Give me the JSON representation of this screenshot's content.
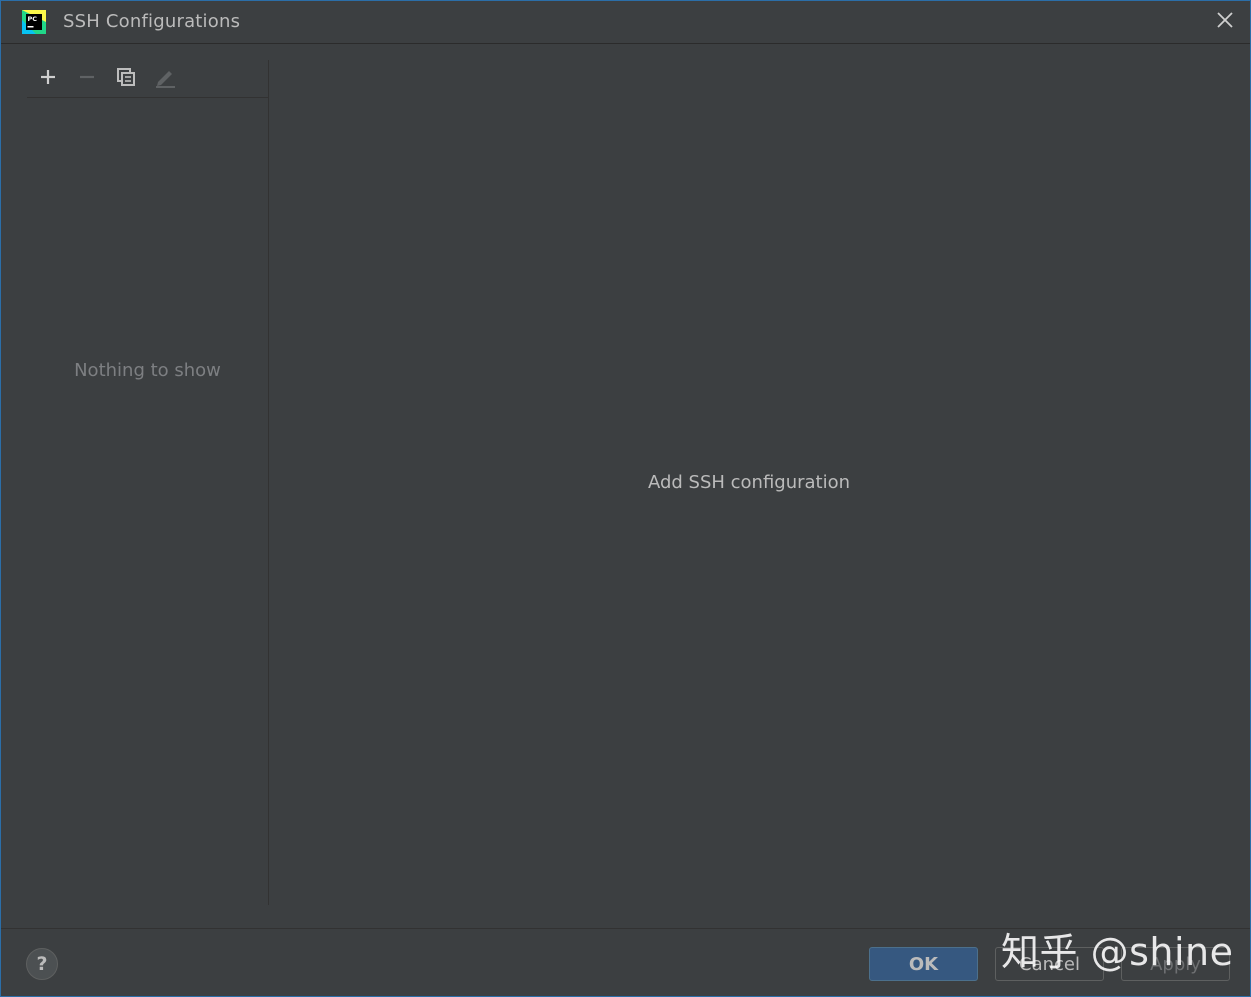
{
  "window": {
    "title": "SSH Configurations",
    "app_icon_label": "PC"
  },
  "toolbar": {
    "add_icon": "plus-icon",
    "remove_icon": "minus-icon",
    "copy_icon": "copy-icon",
    "edit_icon": "pencil-icon"
  },
  "left_panel": {
    "empty_text": "Nothing to show"
  },
  "right_panel": {
    "placeholder_text": "Add SSH configuration"
  },
  "buttons": {
    "help": "?",
    "ok": "OK",
    "cancel": "Cancel",
    "apply": "Apply"
  },
  "watermark": "知乎 @shine",
  "colors": {
    "background": "#3c3f41",
    "primary_button": "#365880",
    "text": "#bbbbbb",
    "muted_text": "#7d7f82"
  }
}
